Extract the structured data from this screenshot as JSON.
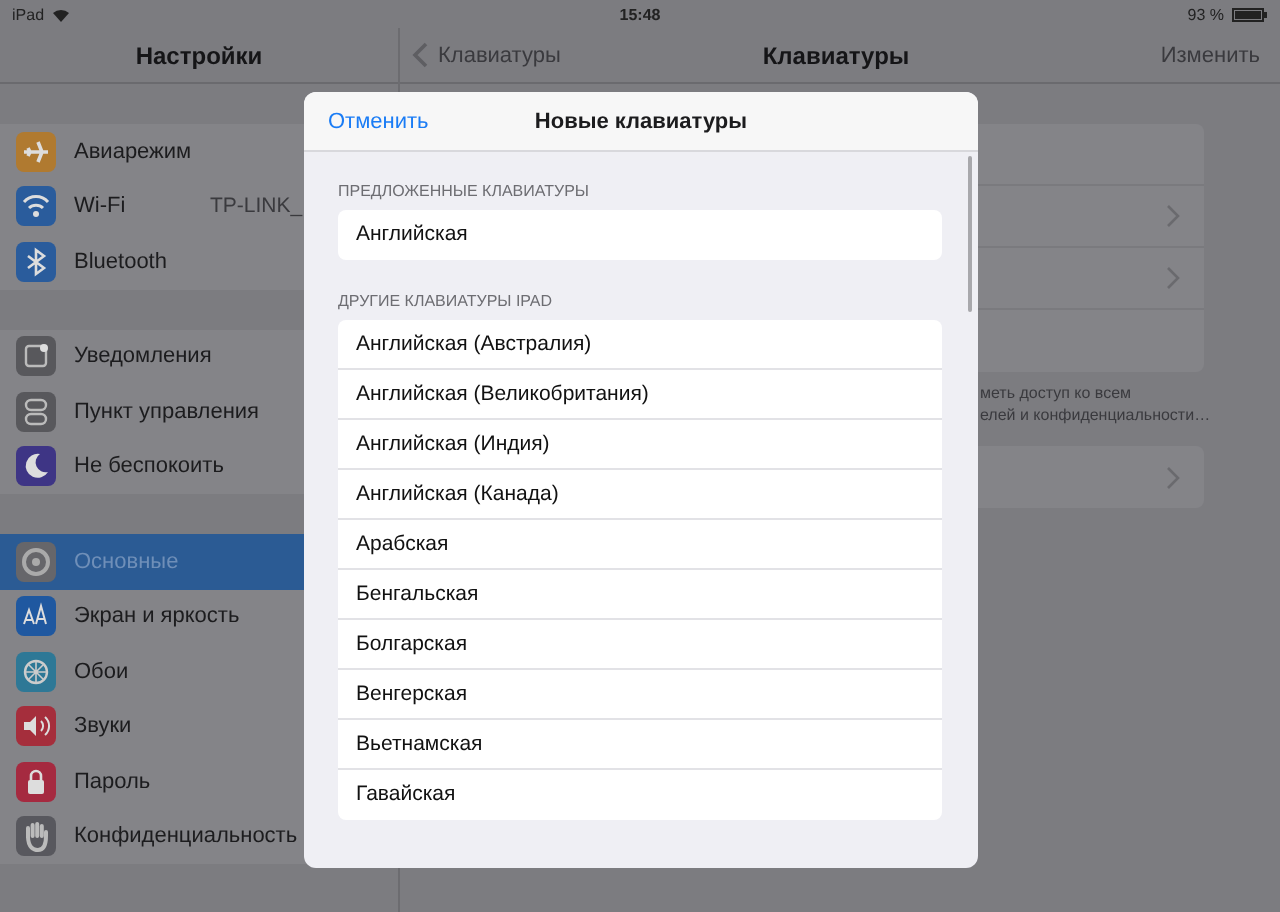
{
  "status_bar": {
    "device": "iPad",
    "time": "15:48",
    "battery": "93 %"
  },
  "sidebar": {
    "title": "Настройки",
    "groups": [
      {
        "items": [
          {
            "label": "Авиарежим",
            "kind": "airplane",
            "selected": false
          },
          {
            "label": "Wi-Fi",
            "kind": "wifi",
            "value": "TP-LINK_",
            "selected": false
          },
          {
            "label": "Bluetooth",
            "kind": "bluetooth",
            "selected": false
          }
        ]
      },
      {
        "items": [
          {
            "label": "Уведомления",
            "kind": "notifications",
            "selected": false
          },
          {
            "label": "Пункт управления",
            "kind": "control",
            "selected": false
          },
          {
            "label": "Не беспокоить",
            "kind": "moon",
            "selected": false
          }
        ]
      },
      {
        "items": [
          {
            "label": "Основные",
            "kind": "gear",
            "selected": true
          },
          {
            "label": "Экран и яркость",
            "kind": "display",
            "selected": false
          },
          {
            "label": "Обои",
            "kind": "wallpaper",
            "selected": false
          },
          {
            "label": "Звуки",
            "kind": "sound",
            "selected": false
          },
          {
            "label": "Пароль",
            "kind": "lock",
            "selected": false
          },
          {
            "label": "Конфиденциальность",
            "kind": "hand",
            "selected": false
          }
        ]
      }
    ]
  },
  "detail": {
    "back": "Клавиатуры",
    "title": "Клавиатуры",
    "action": "Изменить",
    "footer": [
      "меть доступ ко всем",
      "елей и конфиденциальности…"
    ]
  },
  "modal": {
    "cancel": "Отменить",
    "title": "Новые клавиатуры",
    "sections": [
      {
        "header": "ПРЕДЛОЖЕННЫЕ КЛАВИАТУРЫ",
        "items": [
          "Английская"
        ]
      },
      {
        "header": "ДРУГИЕ КЛАВИАТУРЫ IPAD",
        "items": [
          "Английская (Австралия)",
          "Английская (Великобритания)",
          "Английская (Индия)",
          "Английская (Канада)",
          "Арабская",
          "Бенгальская",
          "Болгарская",
          "Венгерская",
          "Вьетнамская",
          "Гавайская"
        ]
      }
    ]
  }
}
